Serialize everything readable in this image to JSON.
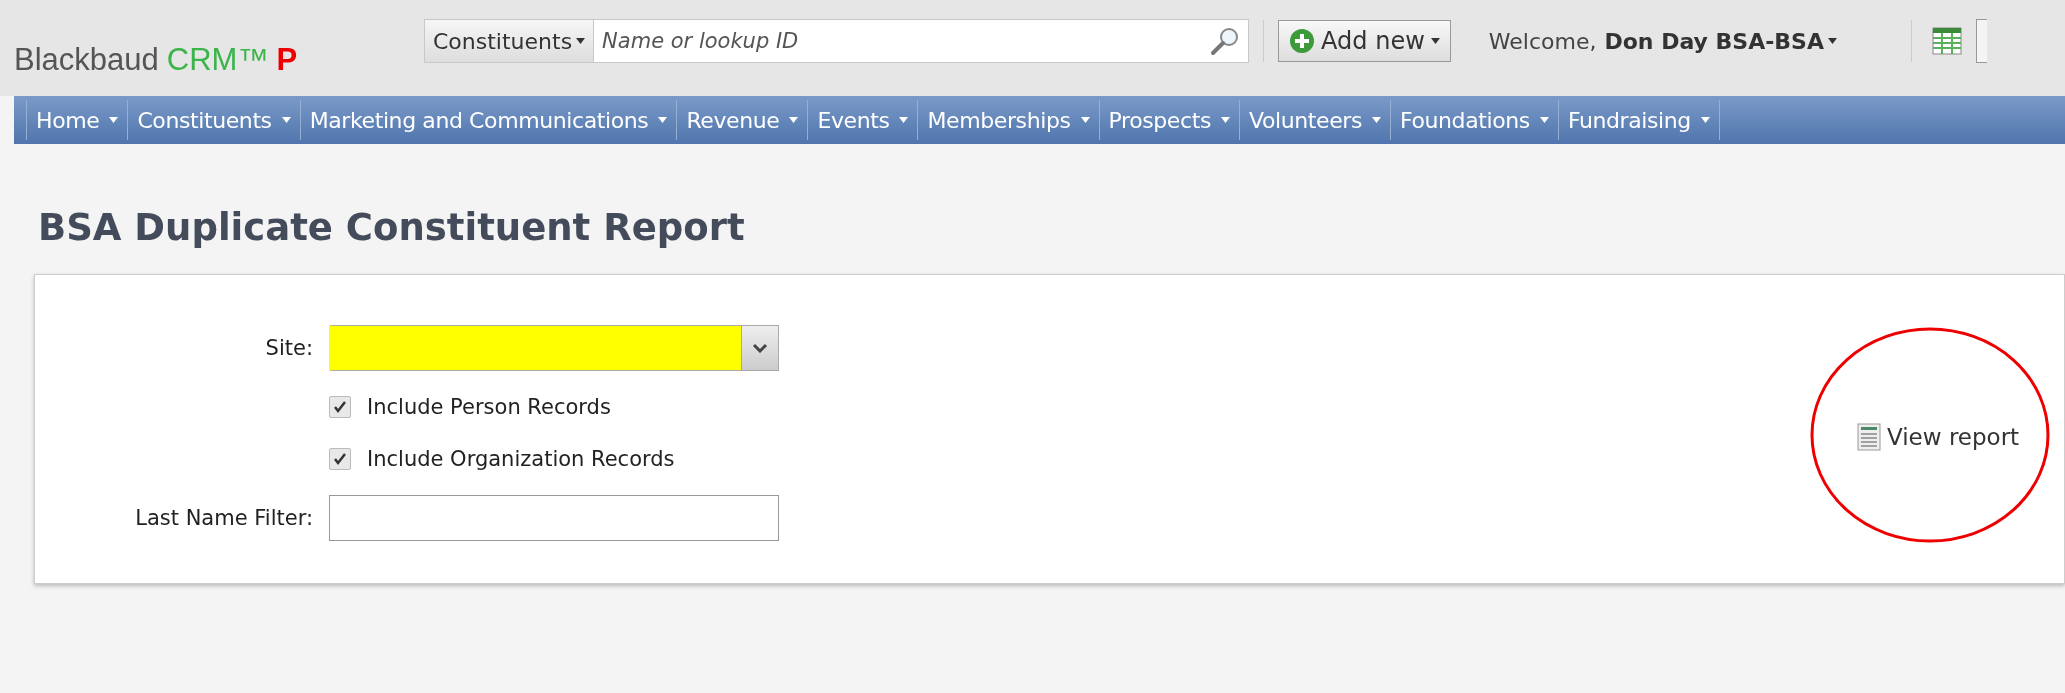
{
  "header": {
    "logo": {
      "brand": "Blackbaud",
      "product": "CRM™",
      "environment": "P"
    },
    "search": {
      "category": "Constituents",
      "placeholder": "Name or lookup ID"
    },
    "add_new": "Add new",
    "welcome": {
      "greeting": "Welcome,",
      "user": "Don Day BSA-BSA"
    }
  },
  "nav": [
    {
      "label": "Home"
    },
    {
      "label": "Constituents"
    },
    {
      "label": "Marketing and Communications"
    },
    {
      "label": "Revenue"
    },
    {
      "label": "Events"
    },
    {
      "label": "Memberships"
    },
    {
      "label": "Prospects"
    },
    {
      "label": "Volunteers"
    },
    {
      "label": "Foundations"
    },
    {
      "label": "Fundraising"
    }
  ],
  "page": {
    "title": "BSA Duplicate Constituent Report",
    "form": {
      "site": {
        "label": "Site:",
        "required": true
      },
      "checkboxes": [
        {
          "label": "Include Person Records",
          "checked": true
        },
        {
          "label": "Include Organization Records",
          "checked": true
        }
      ],
      "last_name": {
        "label": "Last Name Filter:"
      }
    },
    "view_report": "View report"
  }
}
